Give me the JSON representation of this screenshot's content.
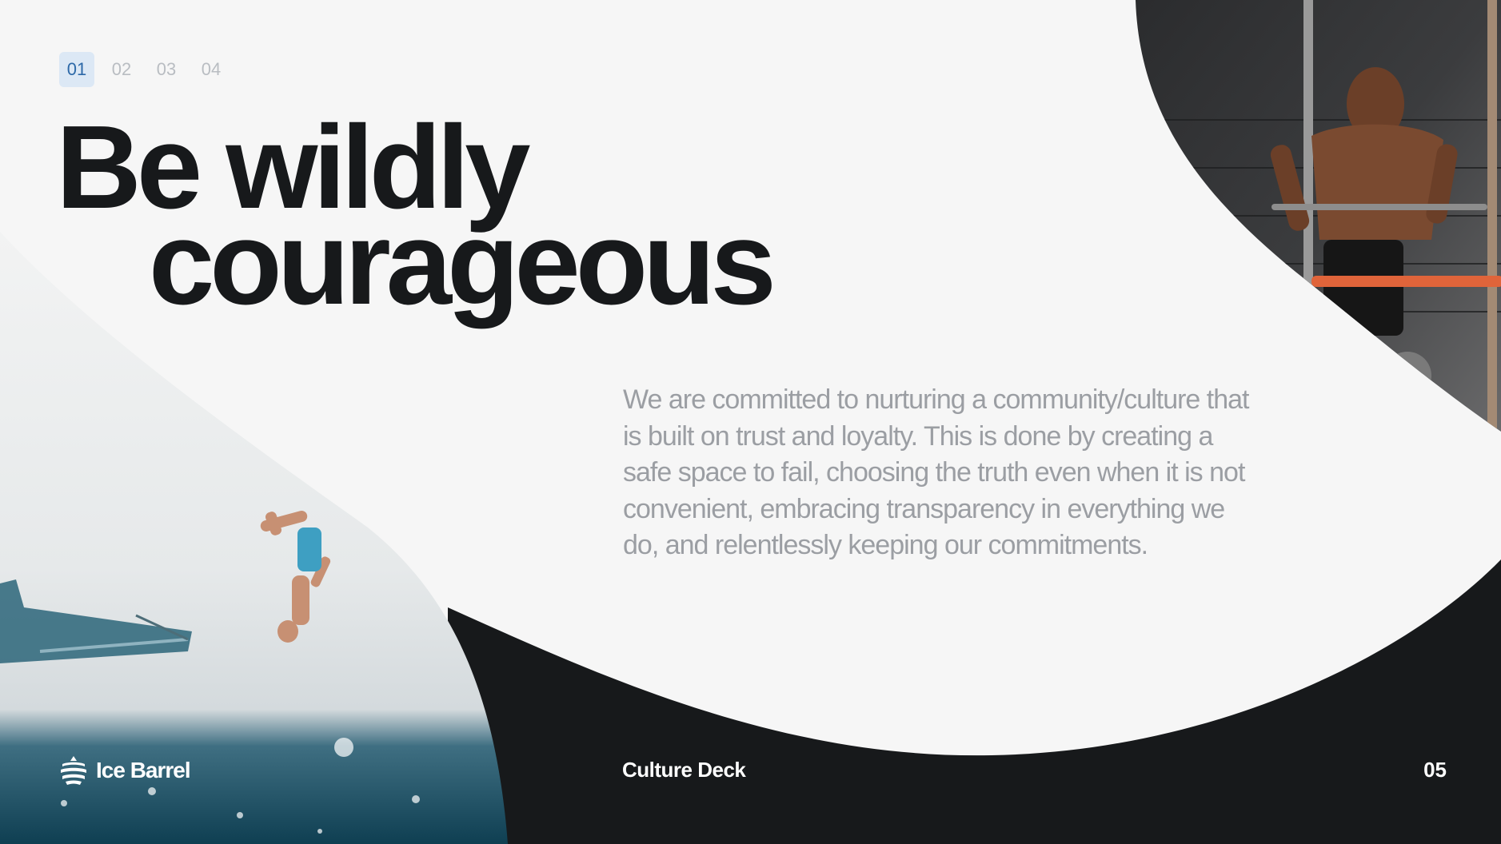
{
  "nav": {
    "tabs": [
      "01",
      "02",
      "03",
      "04"
    ],
    "active_index": 0
  },
  "hero": {
    "line1": "Be wildly",
    "line2": "courageous"
  },
  "body": {
    "text": "We are committed to nurturing a community/culture that is built on trust and loyalty.  This is done by creating a safe space to fail, choosing the truth even when it is not convenient, embracing transparency in everything we do, and relentlessly keeping our commitments."
  },
  "footer": {
    "brand": "Ice Barrel",
    "title": "Culture Deck",
    "page": "05"
  },
  "images": {
    "top_right": "photo of a man doing dips on parallel bars in a gym",
    "bottom_left": "photo of a person backflipping off a boat into the water"
  },
  "colors": {
    "background": "#f6f6f6",
    "dark": "#17191b",
    "accent_tab_bg": "#dce8f5",
    "accent_tab_text": "#2d69a8",
    "body_text": "#9b9ea3"
  }
}
